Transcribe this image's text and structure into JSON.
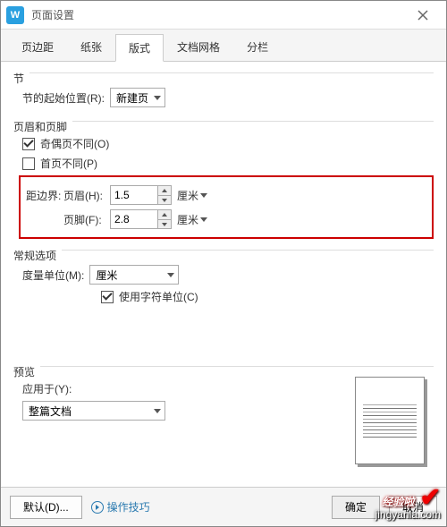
{
  "titlebar": {
    "title": "页面设置"
  },
  "tabs": {
    "items": [
      {
        "label": "页边距"
      },
      {
        "label": "纸张"
      },
      {
        "label": "版式"
      },
      {
        "label": "文档网格"
      },
      {
        "label": "分栏"
      }
    ],
    "active_index": 2
  },
  "section": {
    "group_label": "节",
    "start_label": "节的起始位置(R):",
    "start_value": "新建页"
  },
  "header_footer": {
    "group_label": "页眉和页脚",
    "odd_even_label": "奇偶页不同(O)",
    "odd_even_checked": true,
    "first_page_label": "首页不同(P)",
    "first_page_checked": false,
    "distance_label": "距边界:",
    "header_label": "页眉(H):",
    "header_value": "1.5",
    "header_unit": "厘米",
    "footer_label": "页脚(F):",
    "footer_value": "2.8",
    "footer_unit": "厘米"
  },
  "general": {
    "group_label": "常规选项",
    "unit_label": "度量单位(M):",
    "unit_value": "厘米",
    "char_unit_label": "使用字符单位(C)",
    "char_unit_checked": true
  },
  "preview": {
    "group_label": "预览",
    "apply_label": "应用于(Y):",
    "apply_value": "整篇文档"
  },
  "footer": {
    "default_label": "默认(D)...",
    "tips_label": "操作技巧",
    "ok_label": "确定",
    "cancel_label": "取消"
  },
  "watermark": {
    "line1": "经验啦",
    "check": "✔",
    "line2": "jingyanla.com"
  }
}
